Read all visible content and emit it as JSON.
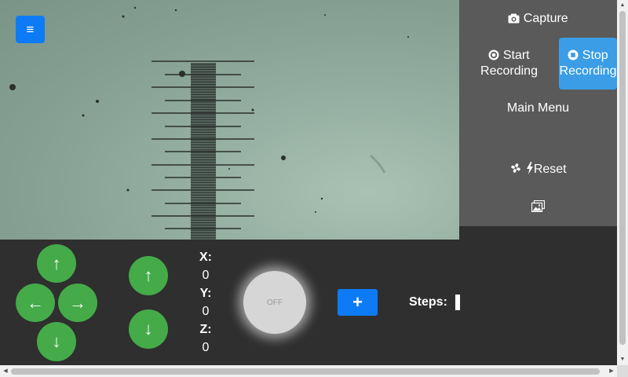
{
  "header": {
    "menu_icon": "hamburger-icon",
    "menu_glyph": "≡"
  },
  "side_panel": {
    "capture_label": "Capture",
    "capture_icon": "camera-icon",
    "start_recording_label_1": "Start",
    "start_recording_label_2": "Recording",
    "start_recording_icon": "record-icon",
    "stop_recording_label_1": "Stop",
    "stop_recording_label_2": "Recording",
    "stop_recording_icon": "stop-icon",
    "main_menu_label": "Main Menu",
    "reset_label": "Reset",
    "reset_icons": [
      "fan-icon",
      "lightning-icon"
    ],
    "gallery_icon": "images-icon"
  },
  "controls": {
    "xy_up": "↑",
    "xy_left": "←",
    "xy_right": "→",
    "xy_down": "↓",
    "z_up": "↑",
    "z_down": "↓",
    "coords": {
      "x_label": "X:",
      "x_value": "0",
      "y_label": "Y:",
      "y_value": "0",
      "z_label": "Z:",
      "z_value": "0"
    },
    "light_toggle": "OFF",
    "add_label": "+",
    "steps_label": "Steps:",
    "steps_value": ""
  },
  "colors": {
    "arrow_button": "#44ab48",
    "primary_button": "#0d7bf5",
    "stop_recording_active": "#3a9de6",
    "side_panel": "#5a5a5a",
    "control_panel": "#2f2f2f"
  }
}
